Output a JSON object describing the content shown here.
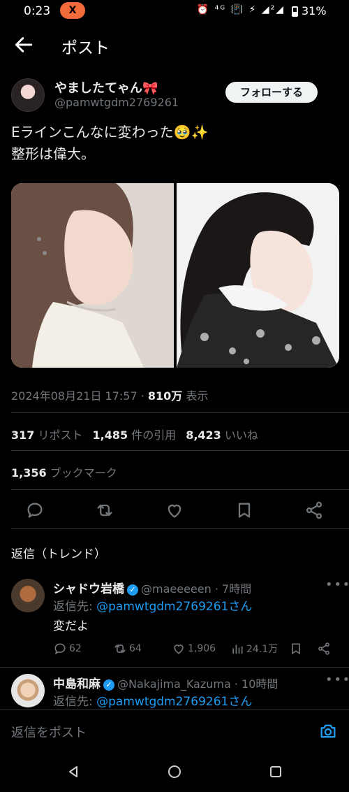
{
  "status_bar": {
    "time": "0:23",
    "app_badge": "X",
    "icons": "⏰ ⁴ᴳ 📳 ⚡ ◢²◢",
    "battery": "31%"
  },
  "header": {
    "title": "ポスト"
  },
  "author": {
    "name": "やましたてゃん🎀",
    "handle": "@pamwtgdm2769261",
    "follow_label": "フォローする"
  },
  "post": {
    "line1": "Eラインこんなに変わった🥹✨",
    "line2": "整形は偉大。"
  },
  "meta": {
    "date": "2024年08月21日 17:57 · ",
    "views": "810万",
    "views_suffix": " 表示"
  },
  "stats": {
    "reposts": "317",
    "reposts_label": " リポスト",
    "quotes": "1,485",
    "quotes_label": " 件の引用",
    "likes": "8,423",
    "likes_label": " いいね",
    "bookmarks": "1,356",
    "bookmarks_label": " ブックマーク"
  },
  "replies_title": "返信（トレンド）",
  "replies": [
    {
      "name": "シャドウ岩橋",
      "handle": "@maeeeeen · 7時間",
      "reply_to_label": "返信先: ",
      "reply_to": "@pamwtgdm2769261さん",
      "text": "変だよ",
      "replies": "62",
      "reposts": "64",
      "likes": "1,906",
      "views": "24.1万"
    },
    {
      "name": "中島和麻",
      "handle": "@Nakajima_Kazuma · 10時間",
      "reply_to_label": "返信先: ",
      "reply_to": "@pamwtgdm2769261さん"
    }
  ],
  "compose": {
    "placeholder": "返信をポスト"
  },
  "colors": {
    "background": "#000000",
    "accent": "#1d9bf0",
    "muted": "#71767b",
    "text": "#e7e9ea"
  },
  "icons": [
    "back-arrow-icon",
    "reply-icon",
    "repost-icon",
    "like-icon",
    "bookmark-icon",
    "share-icon",
    "views-icon",
    "camera-icon",
    "verified-icon",
    "more-icon"
  ]
}
